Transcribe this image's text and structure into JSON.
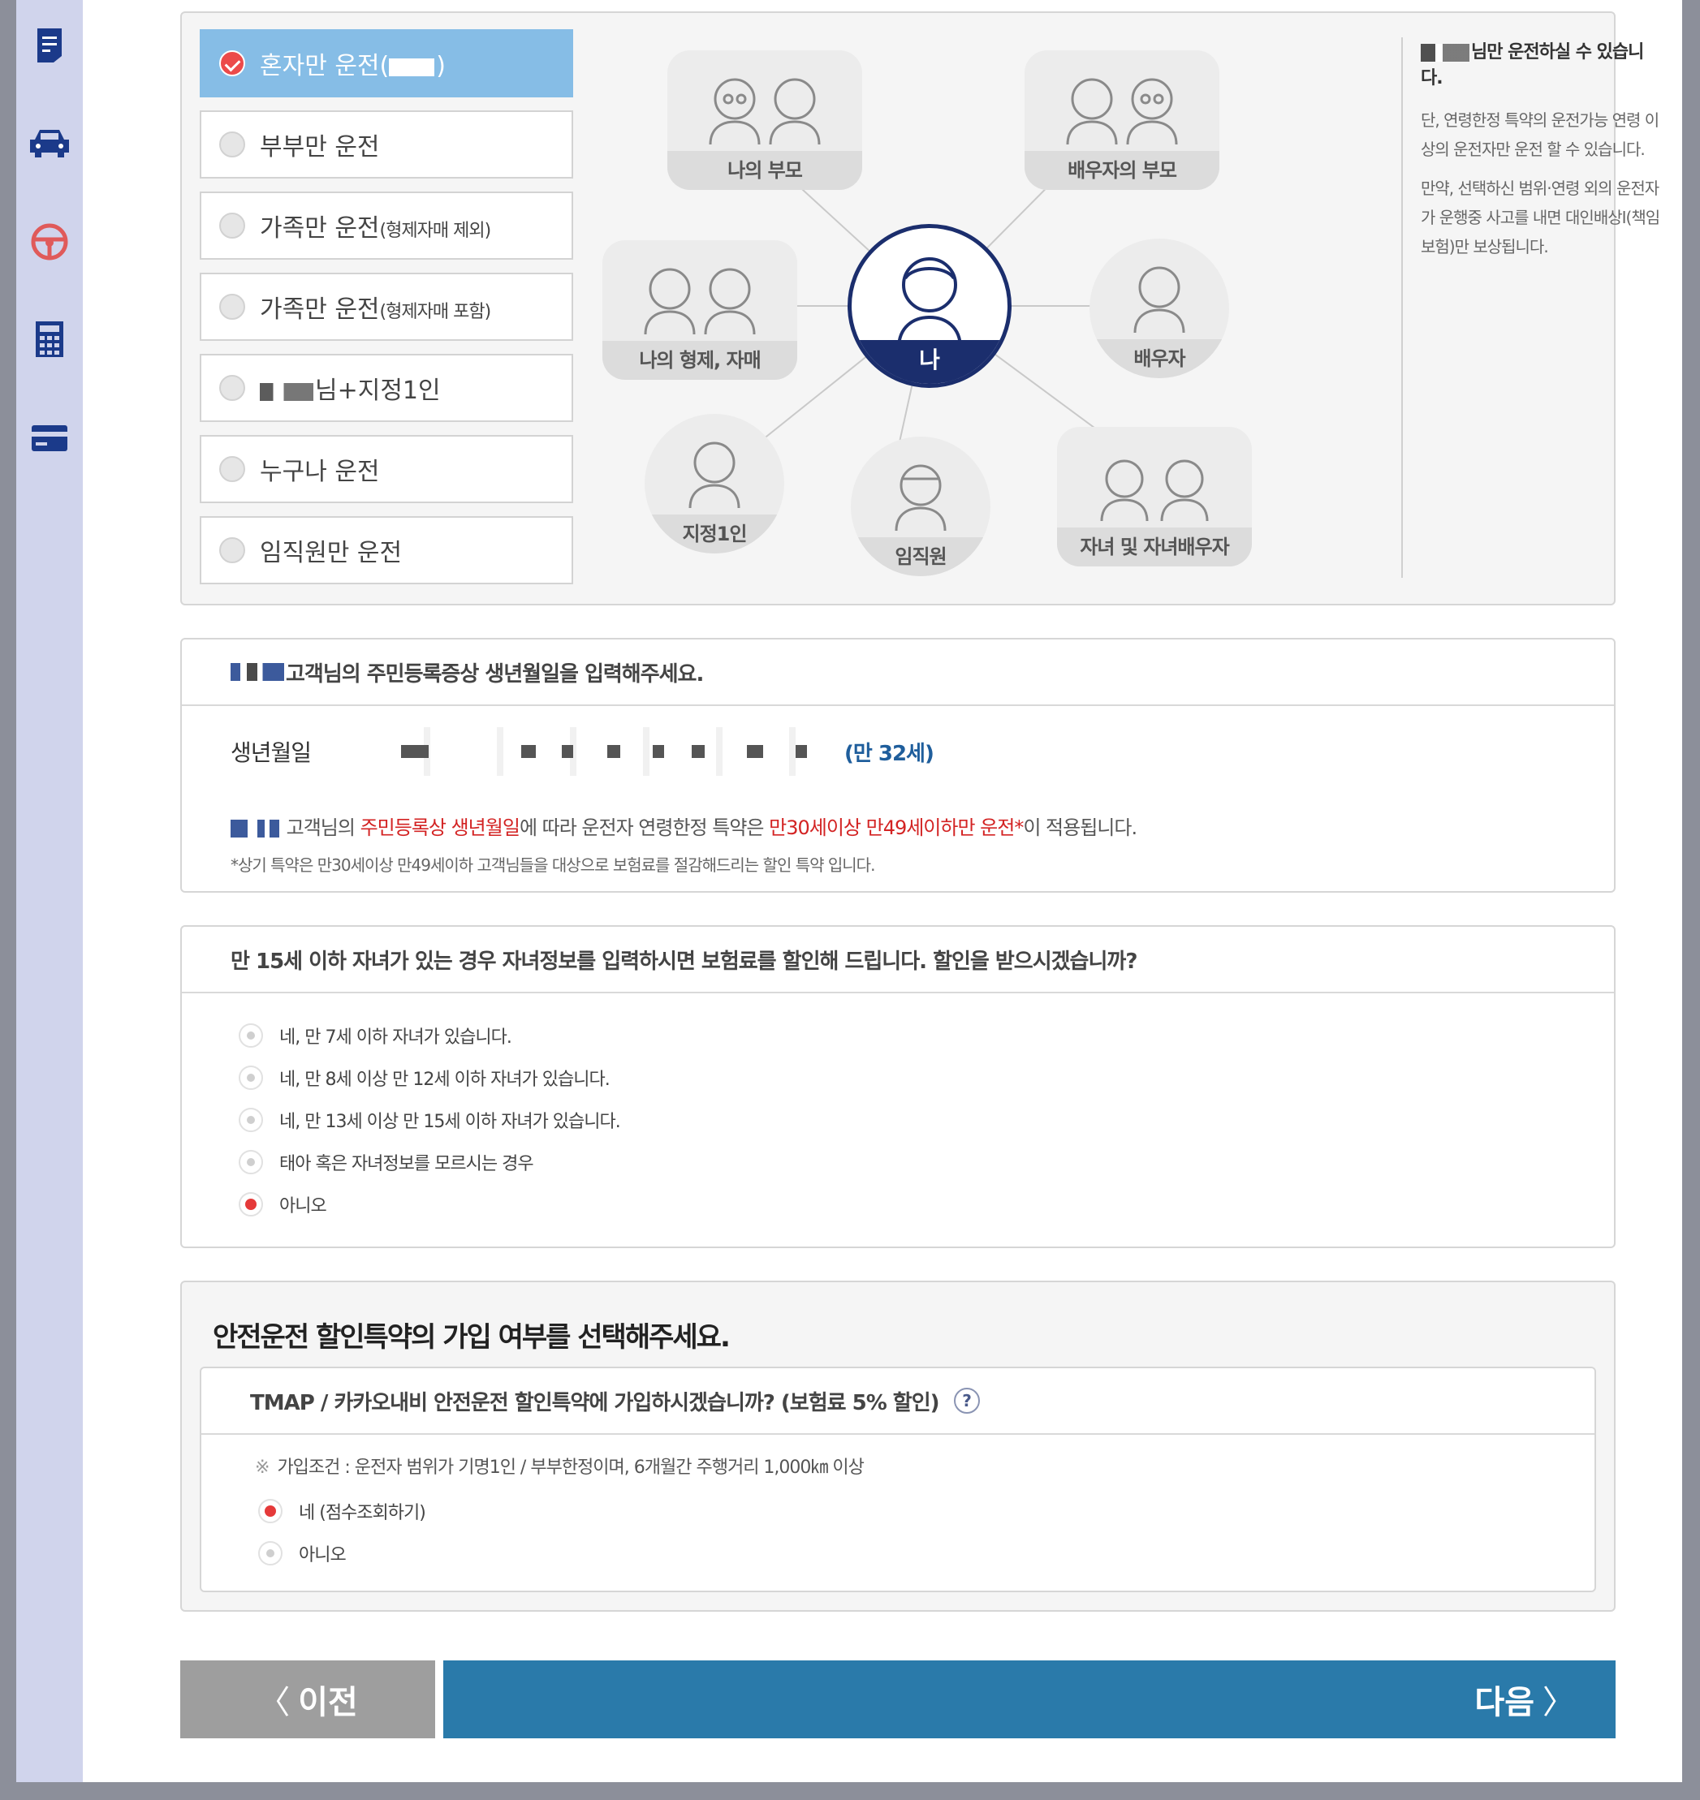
{
  "sidebar": {
    "icons": [
      "document-icon",
      "car-icon",
      "steering-wheel-icon",
      "calculator-icon",
      "credit-card-icon"
    ]
  },
  "driver_scope": {
    "options": [
      {
        "label": "혼자만 운전(",
        "suffix": ")",
        "selected": true
      },
      {
        "label": "부부만 운전",
        "suffix": "",
        "selected": false
      },
      {
        "label": "가족만 운전",
        "suffix": "(형제자매 제외)",
        "selected": false
      },
      {
        "label": "가족만 운전",
        "suffix": "(형제자매 포함)",
        "selected": false
      },
      {
        "label": "님+지정1인",
        "suffix": "",
        "selected": false
      },
      {
        "label": "누구나 운전",
        "suffix": "",
        "selected": false
      },
      {
        "label": "임직원만 운전",
        "suffix": "",
        "selected": false
      }
    ],
    "diagram": {
      "center": "나",
      "nodes": [
        "나의 부모",
        "배우자의 부모",
        "나의 형제, 자매",
        "배우자",
        "지정1인",
        "임직원",
        "자녀 및 자녀배우자"
      ]
    },
    "info": {
      "title": "님만 운전하실 수 있습니다.",
      "p1": "단, 연령한정 특약의 운전가능 연령 이상의 운전자만 운전 할 수 있습니다.",
      "p2": "만약, 선택하신 범위·연령 외의 운전자가 운행중 사고를 내면 대인배상Ⅰ(책임보험)만 보상됩니다."
    }
  },
  "birth": {
    "header": "고객님의 주민등록증상 생년월일을 입력해주세요.",
    "label": "생년월일",
    "age": "(만 32세)",
    "notice_1": " 고객님의 ",
    "notice_red_1": "주민등록상 생년월일",
    "notice_2": "에 따라 운전자 연령한정 특약은 ",
    "notice_red_2": "만30세이상 만49세이하만 운전*",
    "notice_3": "이 적용됩니다.",
    "note": "*상기 특약은 만30세이상 만49세이하 고객님들을 대상으로 보험료를 절감해드리는 할인 특약 입니다."
  },
  "child_discount": {
    "header": "만 15세 이하 자녀가 있는 경우 자녀정보를 입력하시면 보험료를 할인해 드립니다. 할인을 받으시겠습니까?",
    "options": [
      {
        "label": "네, 만 7세 이하 자녀가 있습니다.",
        "selected": false
      },
      {
        "label": "네, 만 8세 이상 만 12세 이하 자녀가 있습니다.",
        "selected": false
      },
      {
        "label": "네, 만 13세 이상 만 15세 이하 자녀가 있습니다.",
        "selected": false
      },
      {
        "label": "태아 혹은 자녀정보를 모르시는 경우",
        "selected": false
      },
      {
        "label": "아니오",
        "selected": true
      }
    ]
  },
  "safe_driving": {
    "title": "안전운전 할인특약의 가입 여부를 선택해주세요.",
    "question": "TMAP / 카카오내비 안전운전 할인특약에 가입하시겠습니까? (보험료 5% 할인)",
    "help": "?",
    "condition_mark": "※",
    "condition": "가입조건 : 운전자 범위가 기명1인 / 부부한정이며, 6개월간 주행거리 1,000㎞ 이상",
    "options": [
      {
        "label": "네 (점수조회하기)",
        "selected": true
      },
      {
        "label": "아니오",
        "selected": false
      }
    ]
  },
  "nav": {
    "prev": "이전",
    "next": "다음",
    "prev_chev": "〈",
    "next_chev": "〉"
  },
  "colors": {
    "selected_option": "#86bde6",
    "radio_on": "#e53a3a",
    "next_button": "#2a7aaa",
    "prev_button": "#9e9e9e",
    "center_node": "#1b2e6d",
    "age_text": "#1f5e9c",
    "notice_red": "#d32323"
  }
}
